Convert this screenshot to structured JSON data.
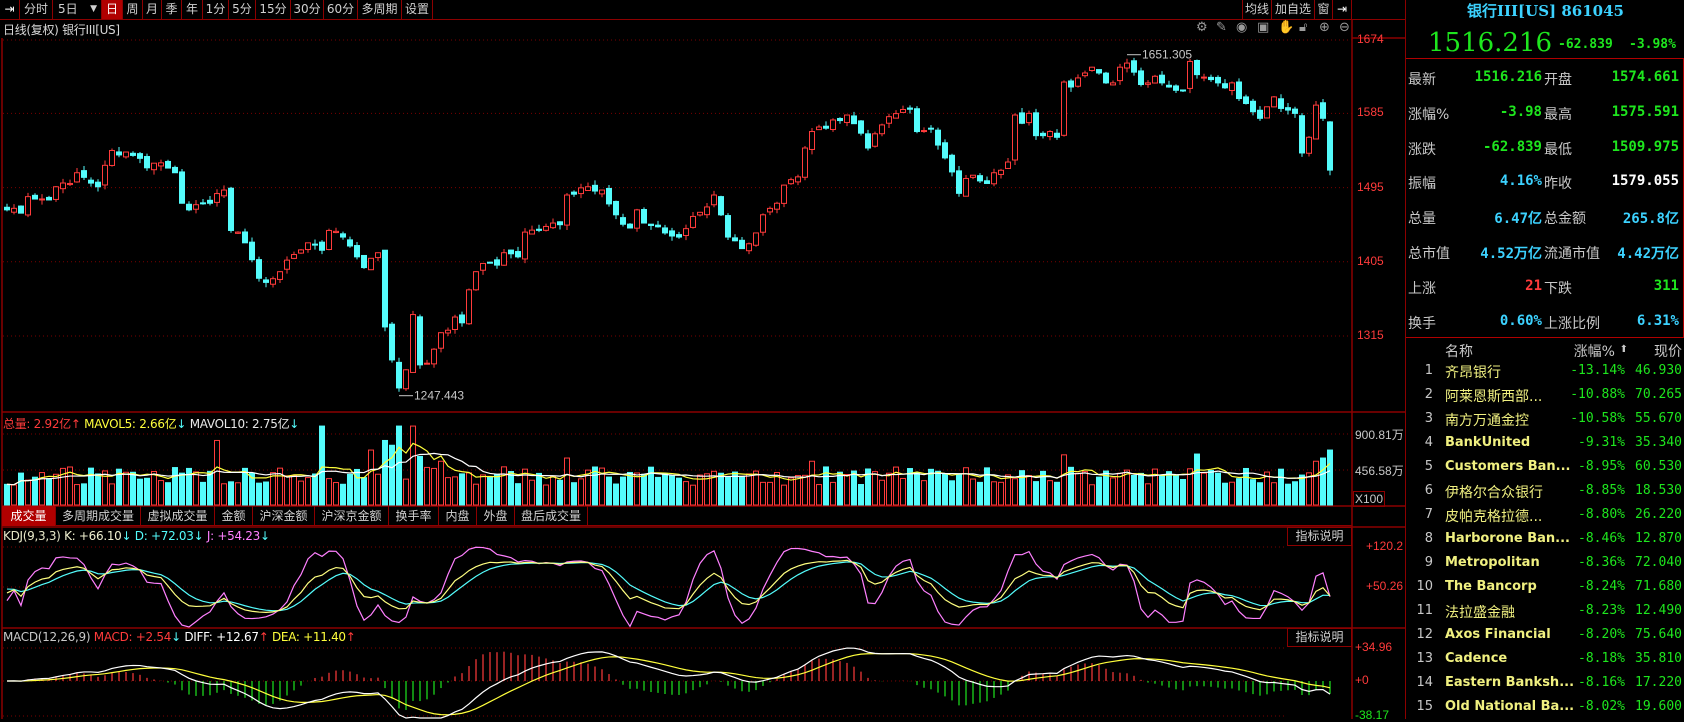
{
  "toolbar": {
    "items": [
      "分时",
      "5日",
      "日",
      "周",
      "月",
      "季",
      "年",
      "1分",
      "5分",
      "15分",
      "30分",
      "60分",
      "多周期",
      "设置"
    ],
    "active": "日",
    "right_items": [
      "均线",
      "加自选",
      "窗"
    ]
  },
  "chart_title": "日线(复权)  银行III[US]",
  "tool_icons": [
    "settings-icon",
    "pen-icon",
    "eye-icon",
    "toolbox-icon",
    "hand-icon",
    "lock-icon",
    "zoom-in-icon",
    "zoom-out-icon"
  ],
  "volume_legend": {
    "total": "总量: 2.92亿",
    "mavol5": "MAVOL5: 2.66亿",
    "mavol10": "MAVOL10: 2.75亿"
  },
  "volume_axis": [
    "900.81万",
    "456.58万",
    "X100"
  ],
  "tabs": [
    "成交量",
    "多周期成交量",
    "虚拟成交量",
    "金额",
    "沪深金额",
    "沪深京金额",
    "换手率",
    "内盘",
    "外盘",
    "盘后成交量"
  ],
  "kdj_legend": {
    "name": "KDJ(9,3,3)",
    "k": "K: +66.10",
    "d": "D: +72.03",
    "j": "J: +54.23"
  },
  "kdj_axis": [
    "+120.2",
    "+50.26"
  ],
  "macd_legend": {
    "name": "MACD(12,26,9)",
    "macd": "MACD: +2.54",
    "diff": "DIFF: +12.67",
    "dea": "DEA: +11.40"
  },
  "macd_axis": [
    "+34.96",
    "+0",
    "-38.17"
  ],
  "explain_label": "指标说明",
  "colors": {
    "up": "#ff3b3b",
    "down": "#54fcfc",
    "grid": "#7a0000",
    "border": "#8c0000",
    "green": "#1ee61e",
    "yellow": "#ffff3c"
  },
  "chart_data": {
    "type": "candlestick",
    "price_axis": [
      1674,
      1585,
      1495,
      1405,
      1315
    ],
    "price_range": [
      1315,
      1674
    ],
    "count": 190,
    "close_anchors": [
      [
        0,
        1468
      ],
      [
        2,
        1464
      ],
      [
        3,
        1484
      ],
      [
        6,
        1480
      ],
      [
        7,
        1496
      ],
      [
        9,
        1500
      ],
      [
        10,
        1513
      ],
      [
        13,
        1496
      ],
      [
        14,
        1522
      ],
      [
        15,
        1540
      ],
      [
        18,
        1534
      ],
      [
        20,
        1519
      ],
      [
        22,
        1525
      ],
      [
        24,
        1513
      ],
      [
        25,
        1476
      ],
      [
        26,
        1468
      ],
      [
        29,
        1476
      ],
      [
        31,
        1492
      ],
      [
        32,
        1443
      ],
      [
        33,
        1441
      ],
      [
        34,
        1428
      ],
      [
        36,
        1385
      ],
      [
        37,
        1380
      ],
      [
        39,
        1393
      ],
      [
        40,
        1407
      ],
      [
        43,
        1428
      ],
      [
        45,
        1419
      ],
      [
        46,
        1443
      ],
      [
        48,
        1435
      ],
      [
        50,
        1411
      ],
      [
        51,
        1398
      ],
      [
        53,
        1416
      ],
      [
        54,
        1326
      ],
      [
        55,
        1286
      ],
      [
        56,
        1252
      ],
      [
        57,
        1274
      ],
      [
        58,
        1341
      ],
      [
        59,
        1280
      ],
      [
        60,
        1282
      ],
      [
        61,
        1299
      ],
      [
        62,
        1319
      ],
      [
        63,
        1322
      ],
      [
        64,
        1338
      ],
      [
        65,
        1331
      ],
      [
        66,
        1371
      ],
      [
        67,
        1393
      ],
      [
        68,
        1403
      ],
      [
        70,
        1401
      ],
      [
        71,
        1416
      ],
      [
        73,
        1411
      ],
      [
        74,
        1441
      ],
      [
        78,
        1452
      ],
      [
        79,
        1450
      ],
      [
        80,
        1486
      ],
      [
        83,
        1496
      ],
      [
        85,
        1492
      ],
      [
        87,
        1462
      ],
      [
        89,
        1446
      ],
      [
        90,
        1468
      ],
      [
        91,
        1452
      ],
      [
        94,
        1440
      ],
      [
        96,
        1435
      ],
      [
        98,
        1460
      ],
      [
        99,
        1465
      ],
      [
        101,
        1486
      ],
      [
        103,
        1435
      ],
      [
        105,
        1421
      ],
      [
        107,
        1440
      ],
      [
        108,
        1462
      ],
      [
        110,
        1476
      ],
      [
        111,
        1498
      ],
      [
        113,
        1508
      ],
      [
        114,
        1543
      ],
      [
        115,
        1563
      ],
      [
        117,
        1567
      ],
      [
        118,
        1577
      ],
      [
        120,
        1583
      ],
      [
        122,
        1561
      ],
      [
        123,
        1543
      ],
      [
        125,
        1571
      ],
      [
        126,
        1581
      ],
      [
        129,
        1590
      ],
      [
        130,
        1563
      ],
      [
        132,
        1566
      ],
      [
        134,
        1531
      ],
      [
        135,
        1514
      ],
      [
        136,
        1488
      ],
      [
        137,
        1506
      ],
      [
        138,
        1510
      ],
      [
        140,
        1500
      ],
      [
        141,
        1513
      ],
      [
        142,
        1516
      ],
      [
        143,
        1526
      ],
      [
        144,
        1583
      ],
      [
        145,
        1573
      ],
      [
        146,
        1585
      ],
      [
        147,
        1558
      ],
      [
        148,
        1558
      ],
      [
        149,
        1563
      ],
      [
        150,
        1556
      ],
      [
        151,
        1623
      ],
      [
        152,
        1617
      ],
      [
        153,
        1628
      ],
      [
        154,
        1634
      ],
      [
        155,
        1641
      ],
      [
        156,
        1634
      ],
      [
        157,
        1622
      ],
      [
        158,
        1622
      ],
      [
        159,
        1641
      ],
      [
        160,
        1646
      ],
      [
        161,
        1635
      ],
      [
        162,
        1620
      ],
      [
        163,
        1622
      ],
      [
        164,
        1630
      ],
      [
        165,
        1622
      ],
      [
        166,
        1617
      ],
      [
        167,
        1613
      ],
      [
        168,
        1613
      ],
      [
        169,
        1648
      ],
      [
        170,
        1632
      ],
      [
        171,
        1629
      ],
      [
        172,
        1626
      ],
      [
        173,
        1622
      ],
      [
        174,
        1616
      ],
      [
        175,
        1622
      ],
      [
        176,
        1603
      ],
      [
        177,
        1597
      ],
      [
        178,
        1587
      ],
      [
        179,
        1579
      ],
      [
        180,
        1593
      ],
      [
        181,
        1605
      ],
      [
        182,
        1591
      ],
      [
        183,
        1589
      ],
      [
        184,
        1585
      ],
      [
        185,
        1537
      ],
      [
        186,
        1556
      ],
      [
        187,
        1595
      ],
      [
        188,
        1579.055
      ],
      [
        189,
        1516.216
      ]
    ],
    "last_candle": {
      "open": 1574.661,
      "high": 1575.591,
      "low": 1509.975,
      "close": 1516.216
    },
    "annotations": [
      {
        "index": 160,
        "value": 1651.305,
        "label": "1651.305",
        "kind": "high"
      },
      {
        "index": 56,
        "value": 1247.443,
        "label": "1247.443",
        "kind": "low"
      }
    ],
    "volume_range_wan": [
      0,
      900.81
    ],
    "volume_spikes_wan": [
      [
        30,
        820
      ],
      [
        45,
        1000
      ],
      [
        52,
        700
      ],
      [
        54,
        820
      ],
      [
        55,
        760
      ],
      [
        56,
        1000
      ],
      [
        58,
        1000
      ],
      [
        59,
        620
      ],
      [
        62,
        560
      ],
      [
        80,
        600
      ],
      [
        115,
        560
      ],
      [
        151,
        640
      ],
      [
        170,
        650
      ],
      [
        187,
        560
      ],
      [
        188,
        600
      ],
      [
        189,
        700
      ]
    ],
    "kdj_range": [
      -20,
      120.2
    ],
    "macd_range": [
      -38.17,
      34.96
    ]
  },
  "quote": {
    "title": "银行III[US] 861045",
    "price": "1516.216",
    "change": "-62.839",
    "pct": "-3.98%",
    "rows": [
      {
        "l1": "最新",
        "v1": "1516.216",
        "c1": "green",
        "l2": "开盘",
        "v2": "1574.661",
        "c2": "green"
      },
      {
        "l1": "涨幅%",
        "v1": "-3.98",
        "c1": "green",
        "l2": "最高",
        "v2": "1575.591",
        "c2": "green"
      },
      {
        "l1": "涨跌",
        "v1": "-62.839",
        "c1": "green",
        "l2": "最低",
        "v2": "1509.975",
        "c2": "green"
      },
      {
        "l1": "振幅",
        "v1": "4.16%",
        "c1": "cyan",
        "l2": "昨收",
        "v2": "1579.055",
        "c2": "white"
      },
      {
        "l1": "总量",
        "v1": "6.47亿",
        "c1": "cyan",
        "l2": "总金额",
        "v2": "265.8亿",
        "c2": "cyan"
      },
      {
        "l1": "总市值",
        "v1": "4.52万亿",
        "c1": "cyan",
        "l2": "流通市值",
        "v2": "4.42万亿",
        "c2": "cyan"
      },
      {
        "l1": "上涨",
        "v1": "21",
        "c1": "red",
        "l2": "下跌",
        "v2": "311",
        "c2": "green"
      },
      {
        "l1": "换手",
        "v1": "0.60%",
        "c1": "cyan",
        "l2": "上涨比例",
        "v2": "6.31%",
        "c2": "cyan"
      }
    ]
  },
  "list": {
    "headers": {
      "name": "名称",
      "pct": "涨幅%",
      "price": "现价"
    },
    "rows": [
      {
        "n": "1",
        "name": "齐昂银行",
        "pct": "-13.14%",
        "price": "46.930"
      },
      {
        "n": "2",
        "name": "阿莱恩斯西部...",
        "pct": "-10.88%",
        "price": "70.265"
      },
      {
        "n": "3",
        "name": "南方万通金控",
        "pct": "-10.58%",
        "price": "55.670"
      },
      {
        "n": "4",
        "name": "BankUnited",
        "pct": "-9.31%",
        "price": "35.340"
      },
      {
        "n": "5",
        "name": "Customers Ban...",
        "pct": "-8.95%",
        "price": "60.530"
      },
      {
        "n": "6",
        "name": "伊格尔合众银行",
        "pct": "-8.85%",
        "price": "18.530"
      },
      {
        "n": "7",
        "name": "皮帕克格拉德...",
        "pct": "-8.80%",
        "price": "26.220"
      },
      {
        "n": "8",
        "name": "Harborone Ban...",
        "pct": "-8.46%",
        "price": "12.870"
      },
      {
        "n": "9",
        "name": "Metropolitan",
        "pct": "-8.36%",
        "price": "72.040"
      },
      {
        "n": "10",
        "name": "The Bancorp",
        "pct": "-8.24%",
        "price": "71.680"
      },
      {
        "n": "11",
        "name": "法拉盛金融",
        "pct": "-8.23%",
        "price": "12.490"
      },
      {
        "n": "12",
        "name": "Axos Financial",
        "pct": "-8.20%",
        "price": "75.640"
      },
      {
        "n": "13",
        "name": "Cadence",
        "pct": "-8.18%",
        "price": "35.810"
      },
      {
        "n": "14",
        "name": "Eastern Banksh...",
        "pct": "-8.16%",
        "price": "17.220"
      },
      {
        "n": "15",
        "name": "Old National Ba...",
        "pct": "-8.02%",
        "price": "19.600"
      }
    ]
  }
}
